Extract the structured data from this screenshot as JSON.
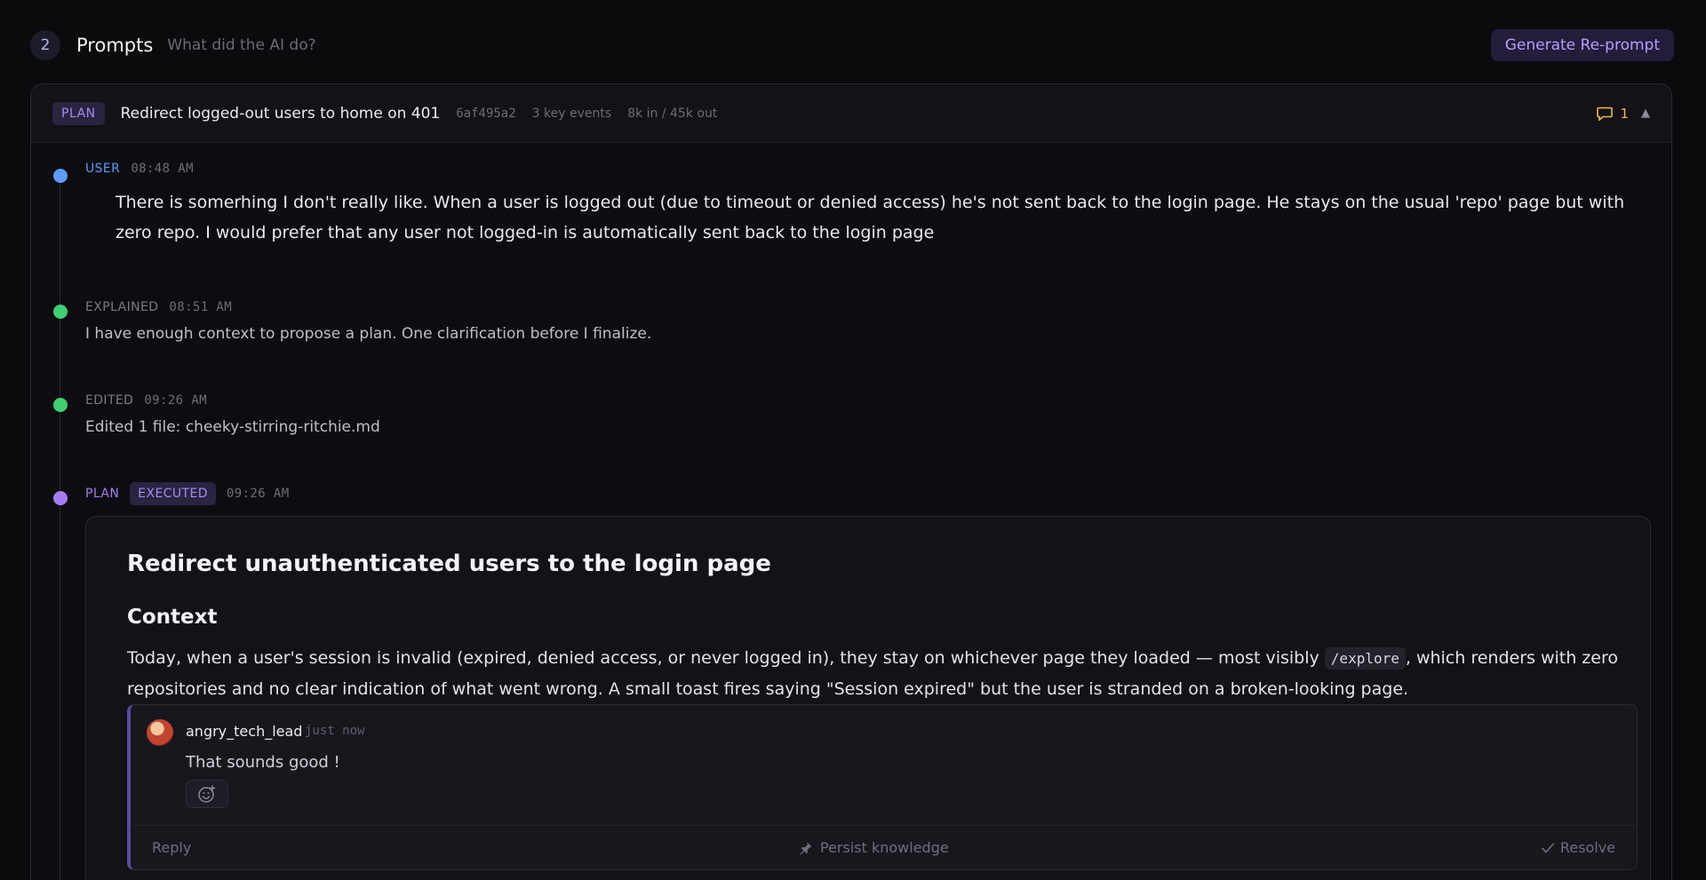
{
  "section": {
    "step": "2",
    "title": "Prompts",
    "subtitle": "What did the AI do?",
    "regenerate_label": "Generate Re-prompt"
  },
  "card": {
    "tag": "PLAN",
    "title": "Redirect logged-out users to home on 401",
    "hash": "6af495a2",
    "events": "3 key events",
    "tokens": "8k in / 45k out",
    "comment_count": "1",
    "collapse_glyph": "▲"
  },
  "events": {
    "user": {
      "label": "USER",
      "time": "08:48 AM",
      "text": "There is somerhing I don't really like. When a user is logged out (due to timeout or denied access) he's not sent back to the login page. He stays on the usual 'repo' page but with zero repo. I would prefer that any user not logged-in is automatically sent back to the login page",
      "color": "#5b9cf5"
    },
    "explained": {
      "label": "EXPLAINED",
      "time": "08:51 AM",
      "text": "I have enough context to propose a plan. One clarification before I finalize.",
      "color": "#3fcf73"
    },
    "edited": {
      "label": "EDITED",
      "time": "09:26 AM",
      "text": "Edited 1 file: cheeky-stirring-ritchie.md",
      "color": "#3fcf73"
    },
    "plan": {
      "label": "PLAN",
      "status": "EXECUTED",
      "time": "09:26 AM",
      "color": "#a47cf0"
    }
  },
  "plan_doc": {
    "h1": "Redirect unauthenticated users to the login page",
    "h2": "Context",
    "p_before": "Today, when a user's session is invalid (expired, denied access, or never logged in), they stay on whichever page they loaded — most visibly ",
    "p_code": "/explore",
    "p_after": ", which renders with zero repositories and no clear indication of what went wrong. A small toast fires saying \"Session expired\" but the user is stranded on a broken-looking page."
  },
  "comment": {
    "author": "angry_tech_lead",
    "time": "just now",
    "body": "That sounds good !",
    "reply_label": "Reply",
    "persist_label": "Persist knowledge",
    "resolve_label": "Resolve"
  }
}
